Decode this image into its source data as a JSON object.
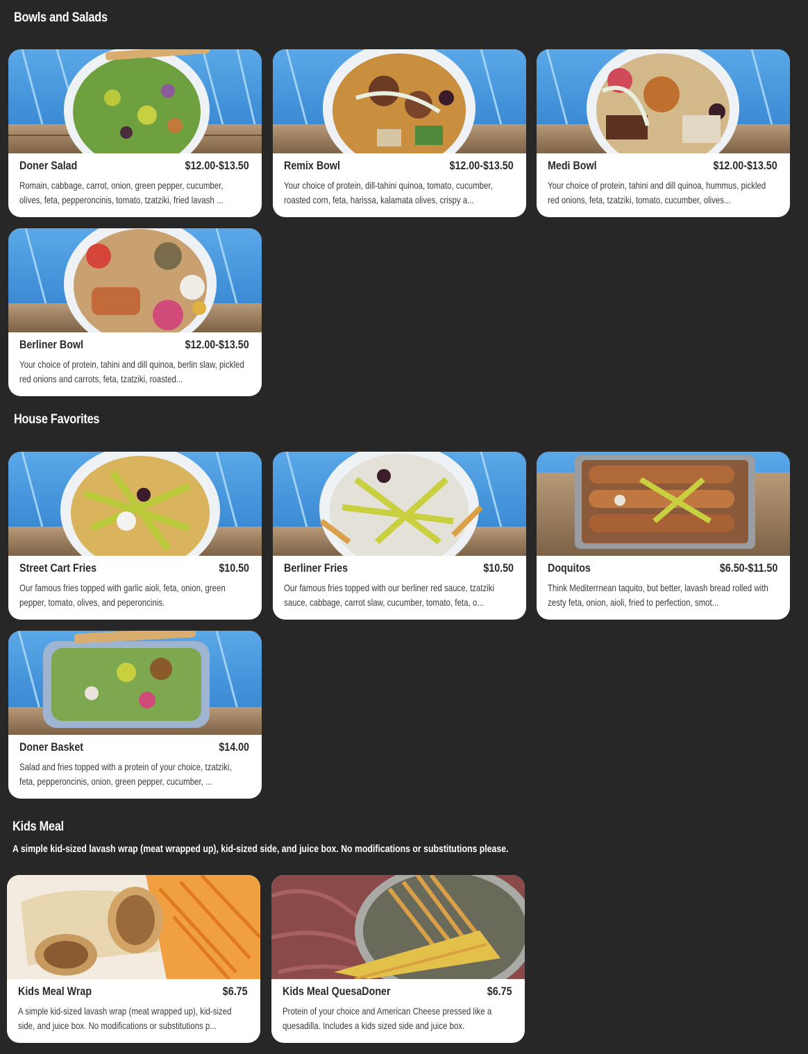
{
  "sections": [
    {
      "title": "Bowls and Salads",
      "items": [
        {
          "name": "Doner Salad",
          "price": "$12.00-$13.50",
          "description": "Romain, cabbage, carrot, onion, green pepper, cucumber, olives, feta, pepperoncinis, tomato, tzatziki, fried lavash ...",
          "image": "bowl-salad-photo"
        },
        {
          "name": "Remix Bowl",
          "price": "$12.00-$13.50",
          "description": "Your choice of protein, dill-tahini quinoa, tomato, cucumber, roasted corn, feta, harissa, kalamata olives, crispy a...",
          "image": "bowl-remix-photo"
        },
        {
          "name": "Medi Bowl",
          "price": "$12.00-$13.50",
          "description": "Your choice of protein, tahini and dill quinoa, hummus, pickled red onions, feta, tzatziki, tomato, cucumber, olives...",
          "image": "bowl-medi-photo"
        },
        {
          "name": "Berliner Bowl",
          "price": "$12.00-$13.50",
          "description": "Your choice of protein, tahini and dill quinoa, berlin slaw, pickled red onions and carrots, feta, tzatziki, roasted...",
          "image": "bowl-berliner-photo"
        }
      ]
    },
    {
      "title": "House Favorites",
      "items": [
        {
          "name": "Street Cart Fries",
          "price": "$10.50",
          "description": "Our famous fries topped with garlic aioli, feta, onion, green pepper, tomato, olives, and peperoncinis.",
          "image": "fries-bowl-photo"
        },
        {
          "name": "Berliner Fries",
          "price": "$10.50",
          "description": "Our famous fries topped with our berliner red sauce, tzatziki sauce, cabbage, carrot slaw, cucumber, tomato, feta, o...",
          "image": "fries-bowl-photo"
        },
        {
          "name": "Doquitos",
          "price": "$6.50-$11.50",
          "description": "Think Mediterrnean taquito, but better, lavash bread rolled with zesty feta, onion, aioli, fried to perfection, smot...",
          "image": "tray-photo"
        },
        {
          "name": "Doner Basket",
          "price": "$14.00",
          "description": "Salad and fries topped with a protein of your choice, tzatziki, feta, pepperoncinis, onion, green pepper, cucumber, ...",
          "image": "basket-photo"
        }
      ]
    },
    {
      "title": "Kids Meal",
      "description": "A simple kid-sized lavash wrap (meat wrapped up), kid-sized side, and juice box. No modifications or substitutions please.",
      "items": [
        {
          "name": "Kids Meal Wrap",
          "price": "$6.75",
          "description": "A simple kid-sized lavash wrap (meat wrapped up), kid-sized side, and juice box. No modifications or substitutions p...",
          "image": "wrap-photo"
        },
        {
          "name": "Kids Meal QuesaDoner",
          "price": "$6.75",
          "description": "Protein of your choice and American Cheese pressed like a quesadilla. Includes a kids sized side and juice box.",
          "image": "quesadilla-photo"
        }
      ]
    }
  ],
  "colors": {
    "background": "#272727",
    "card": "#ffffff",
    "text_dark": "#2a2a2a",
    "wall_blue": "#3d8fd6",
    "wood": "#a08060"
  }
}
